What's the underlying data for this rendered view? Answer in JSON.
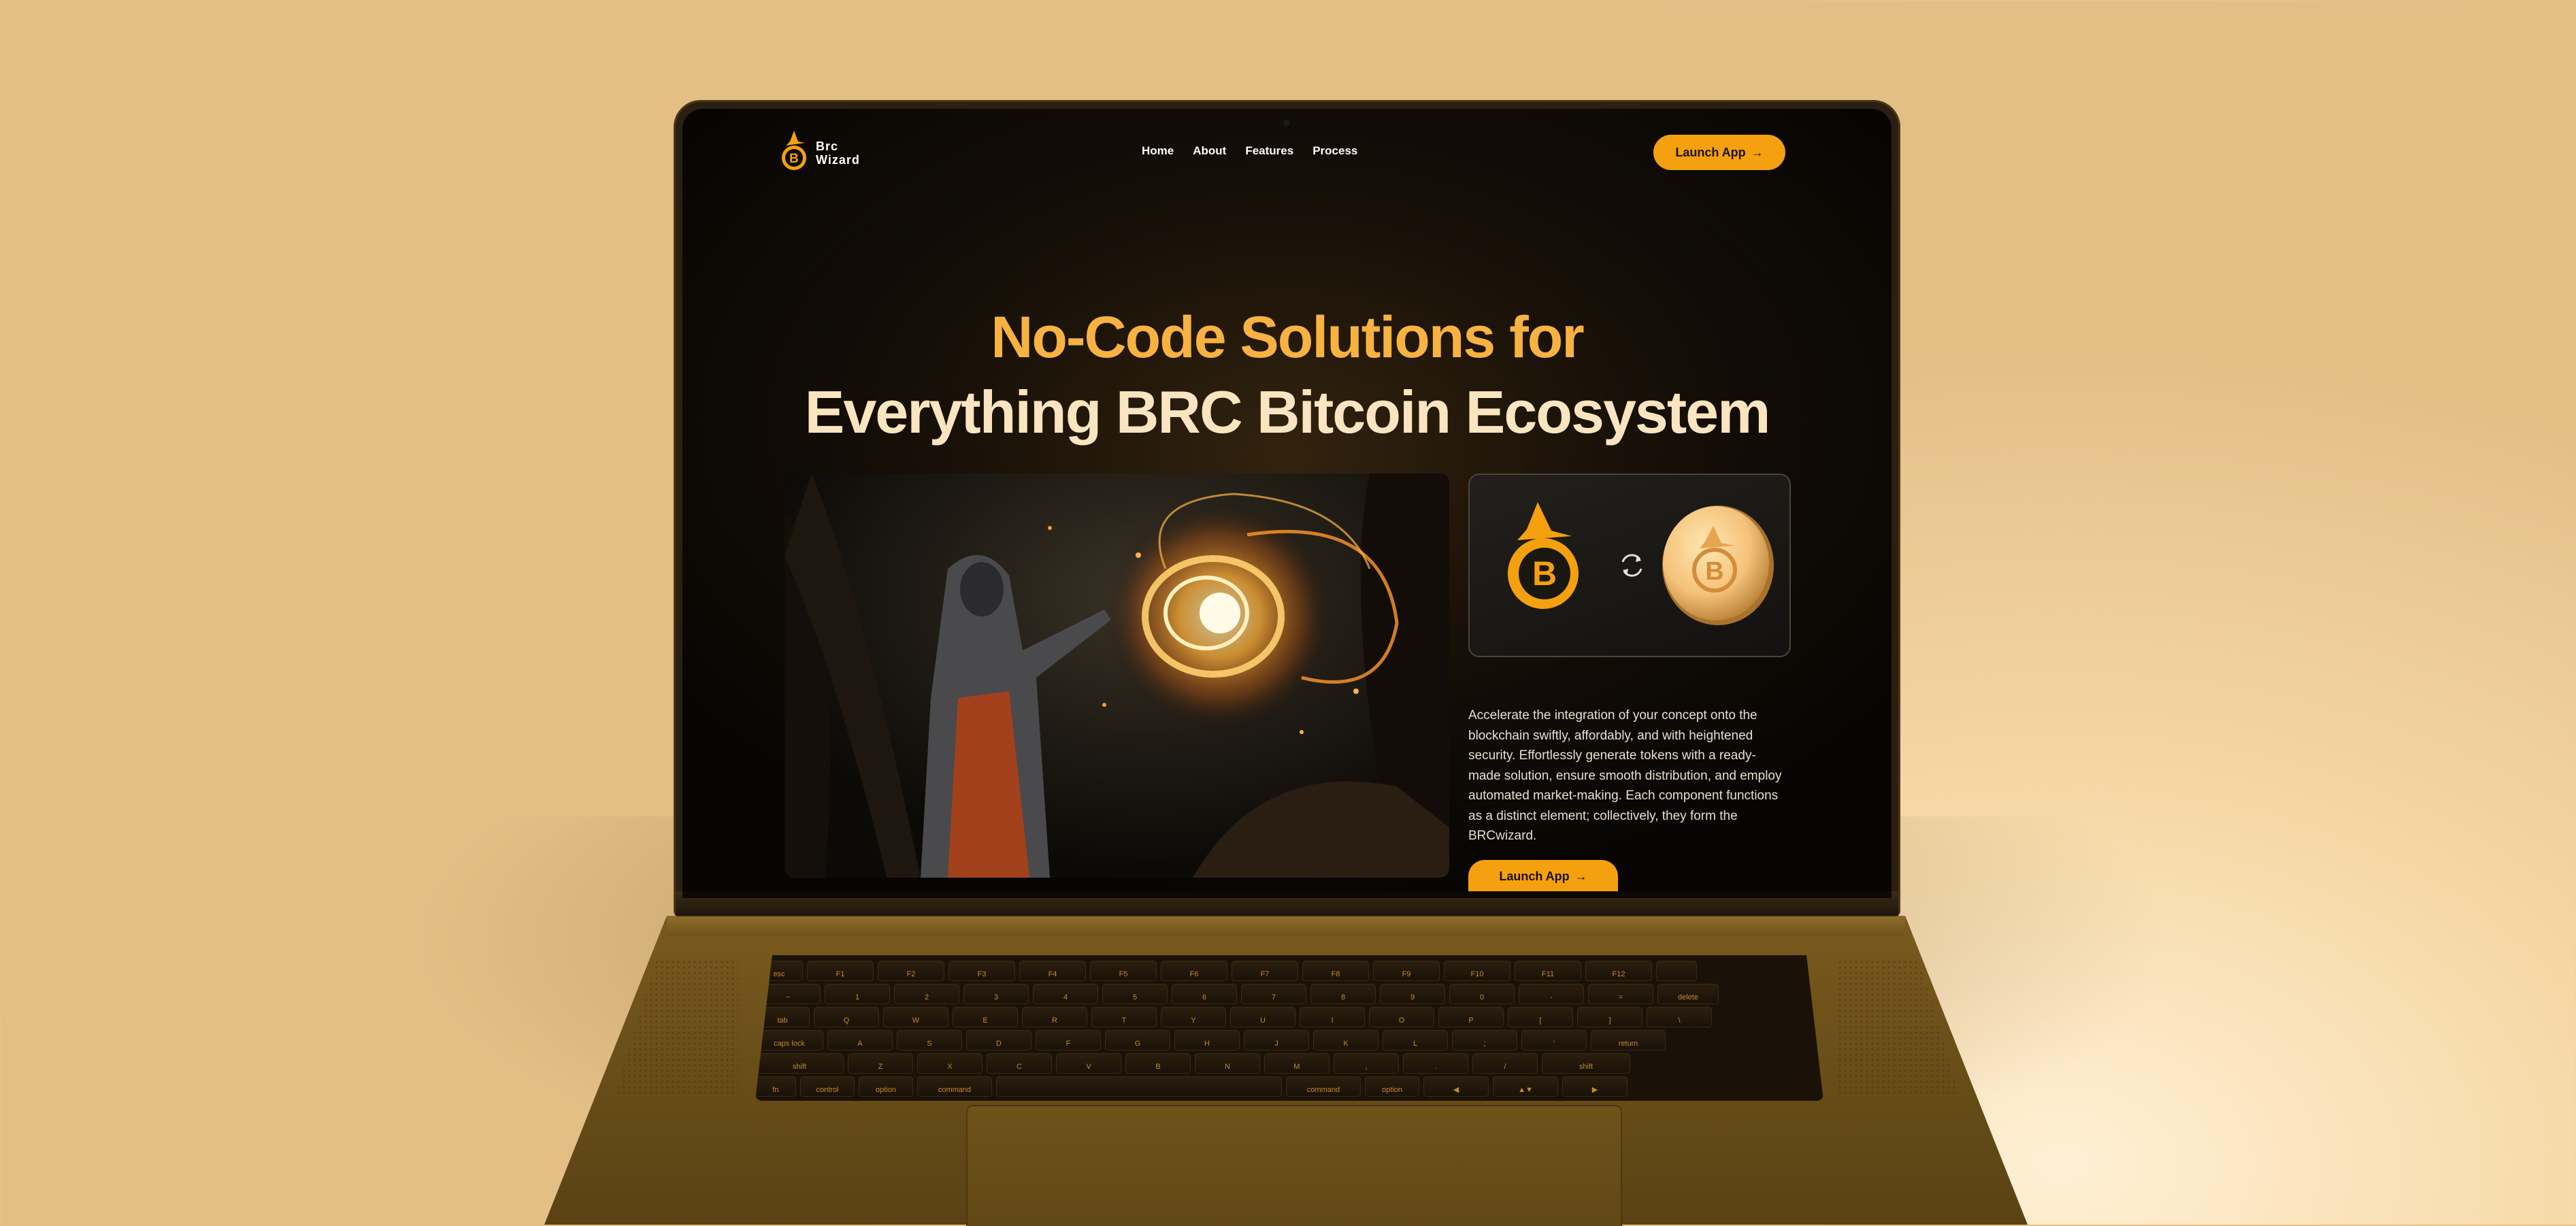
{
  "nav": {
    "logo_line1": "Brc",
    "logo_line2": "Wizard",
    "links": [
      "Home",
      "About",
      "Features",
      "Process"
    ],
    "launch_label": "Launch App"
  },
  "hero": {
    "headline_line1": "No-Code Solutions for",
    "headline_line2": "Everything BRC Bitcoin Ecosystem",
    "description": "Accelerate the integration of your concept onto the blockchain swiftly, affordably, and with heightened security. Effortlessly generate tokens with a ready-made solution, ensure smooth distribution, and employ automated market-making. Each component functions as a distinct element; collectively, they form the BRCwizard.",
    "launch_label": "Launch App"
  },
  "keyboard": {
    "row1": [
      "esc",
      "F1",
      "F2",
      "F3",
      "F4",
      "F5",
      "F6",
      "F7",
      "F8",
      "F9",
      "F10",
      "F11",
      "F12",
      ""
    ],
    "row2": [
      "~",
      "1",
      "2",
      "3",
      "4",
      "5",
      "6",
      "7",
      "8",
      "9",
      "0",
      "-",
      "=",
      "delete"
    ],
    "row3": [
      "tab",
      "Q",
      "W",
      "E",
      "R",
      "T",
      "Y",
      "U",
      "I",
      "O",
      "P",
      "[",
      "]",
      "\\"
    ],
    "row4": [
      "caps lock",
      "A",
      "S",
      "D",
      "F",
      "G",
      "H",
      "J",
      "K",
      "L",
      ";",
      "'",
      "return"
    ],
    "row5": [
      "shift",
      "Z",
      "X",
      "C",
      "V",
      "B",
      "N",
      "M",
      ",",
      ".",
      "/",
      "shift"
    ],
    "row6": [
      "fn",
      "control",
      "option",
      "command",
      "",
      "command",
      "option",
      "◀",
      "▲▼",
      "▶"
    ]
  },
  "colors": {
    "accent": "#f5a00f",
    "headline_gold": "#f7b242",
    "headline_cream": "#fbe5c0",
    "background": "#f6d8a6"
  }
}
